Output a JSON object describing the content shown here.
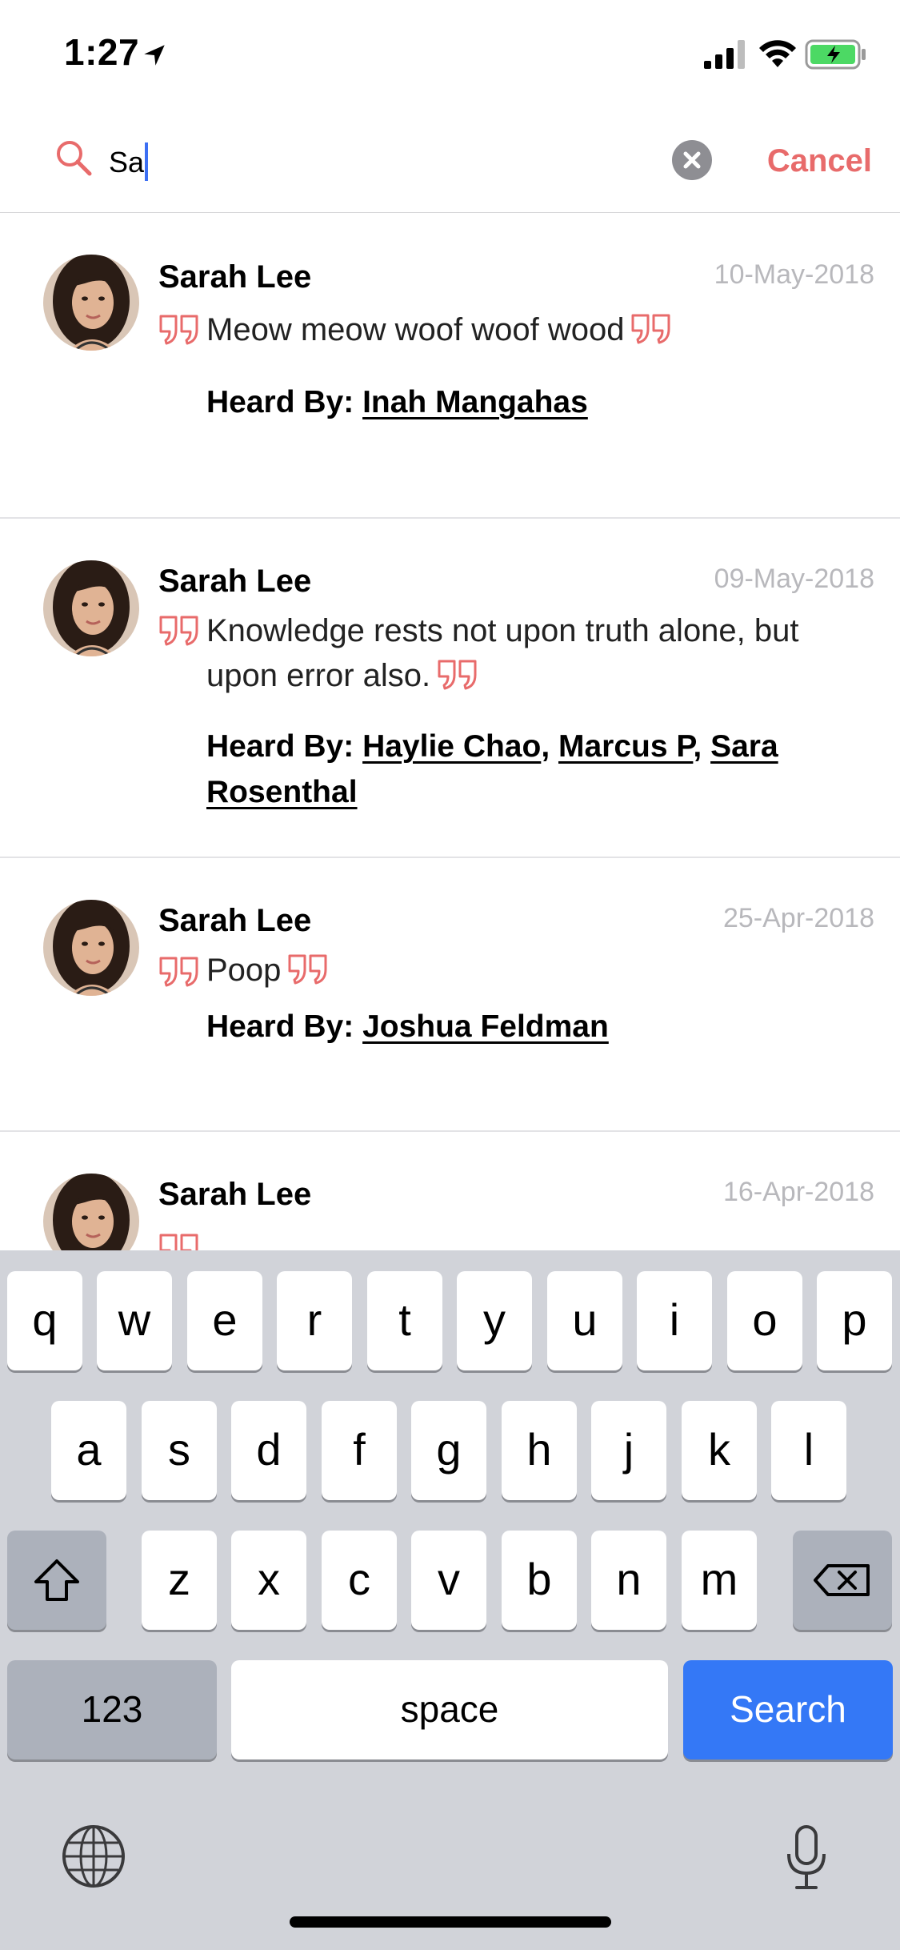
{
  "status_bar": {
    "time": "1:27"
  },
  "search": {
    "query": "Sa",
    "cancel_label": "Cancel"
  },
  "results": [
    {
      "name": "Sarah Lee",
      "date": "10-May-2018",
      "quote": "Meow meow woof woof wood",
      "heard_by_label": "Heard By:",
      "heard_by": [
        "Inah Mangahas"
      ]
    },
    {
      "name": "Sarah Lee",
      "date": "09-May-2018",
      "quote": "Knowledge rests not upon truth alone, but upon error also.",
      "heard_by_label": "Heard By:",
      "heard_by": [
        "Haylie Chao",
        "Marcus P",
        "Sara Rosenthal"
      ]
    },
    {
      "name": "Sarah Lee",
      "date": "25-Apr-2018",
      "quote": "Poop",
      "heard_by_label": "Heard By:",
      "heard_by": [
        "Joshua Feldman"
      ]
    },
    {
      "name": "Sarah Lee",
      "date": "16-Apr-2018"
    }
  ],
  "keyboard": {
    "row1": [
      "q",
      "w",
      "e",
      "r",
      "t",
      "y",
      "u",
      "i",
      "o",
      "p"
    ],
    "row2": [
      "a",
      "s",
      "d",
      "f",
      "g",
      "h",
      "j",
      "k",
      "l"
    ],
    "row3": [
      "z",
      "x",
      "c",
      "v",
      "b",
      "n",
      "m"
    ],
    "numbers_label": "123",
    "space_label": "space",
    "search_label": "Search"
  },
  "colors": {
    "accent": "#e86b6b",
    "search_key": "#3478f6",
    "caret": "#3c6ff3"
  },
  "icons": [
    "location-arrow-icon",
    "signal-icon",
    "wifi-icon",
    "battery-icon",
    "search-icon",
    "clear-icon",
    "quote-open-icon",
    "quote-close-icon",
    "shift-icon",
    "delete-icon",
    "globe-icon",
    "microphone-icon"
  ]
}
